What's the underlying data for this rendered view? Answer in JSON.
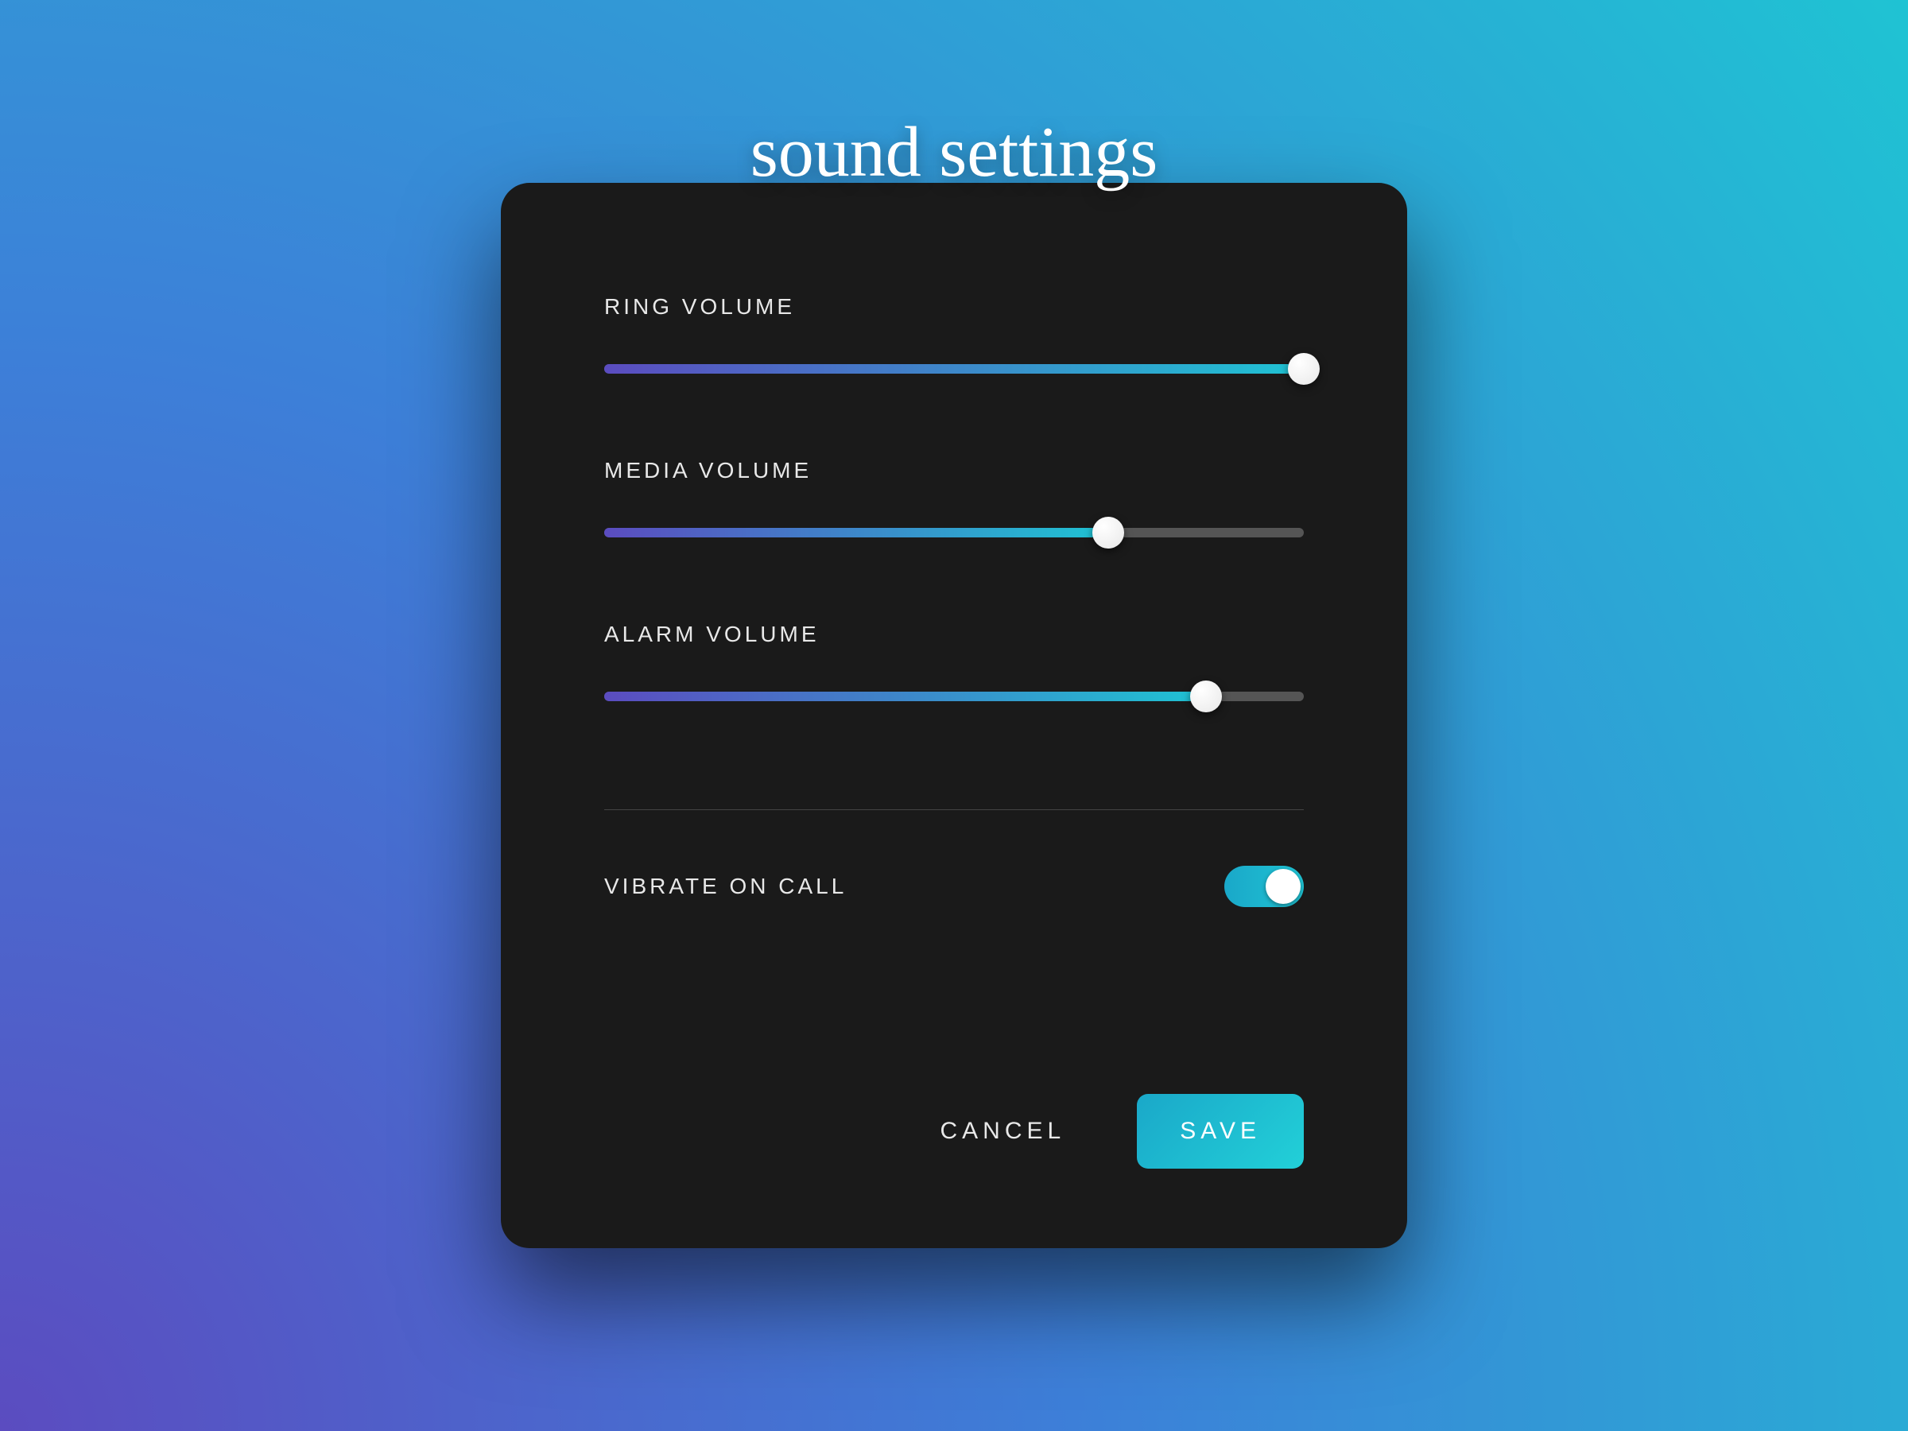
{
  "title": "sound settings",
  "sliders": [
    {
      "label": "RING VOLUME",
      "value": 100
    },
    {
      "label": "MEDIA VOLUME",
      "value": 72
    },
    {
      "label": "ALARM VOLUME",
      "value": 86
    }
  ],
  "toggle": {
    "label": "VIBRATE ON CALL",
    "on": true
  },
  "actions": {
    "cancel": "CANCEL",
    "save": "SAVE"
  },
  "colors": {
    "panel": "#1a1a1a",
    "gradient_start": "#5b4cc0",
    "gradient_end": "#1fc3d3",
    "accent": "#1fc3d3"
  }
}
